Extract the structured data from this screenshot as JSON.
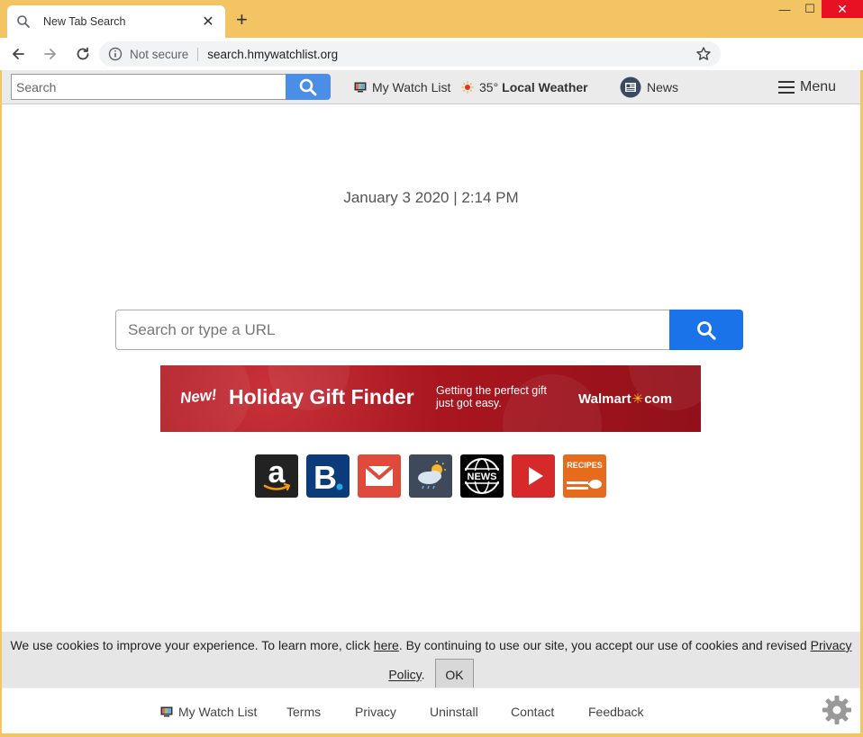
{
  "browser": {
    "tab_title": "New Tab Search",
    "new_tab_label": "+",
    "security_label": "Not secure",
    "url": "search.hmywatchlist.org",
    "window_controls": {
      "minimize": "—",
      "maximize": "☐",
      "close": "✕"
    }
  },
  "topbar": {
    "search_placeholder": "Search",
    "watchlist_label": "My Watch List",
    "weather_temp": "35°",
    "weather_label": "Local Weather",
    "news_label": "News",
    "menu_label": "Menu"
  },
  "main": {
    "datetime": "January 3 2020 | 2:14 PM",
    "search_placeholder": "Search or type a URL"
  },
  "banner": {
    "badge": "New!",
    "title": "Holiday Gift Finder",
    "tagline": "Getting the perfect gift just got easy.",
    "brand_left": "Walmart",
    "brand_right": "com"
  },
  "tiles": {
    "amazon_letter": "a",
    "booking_letter": "B",
    "news_label": "NEWS",
    "recipes_label": "RECIPES"
  },
  "cookie": {
    "text_before": "We use cookies to improve your experience. To learn more, click ",
    "here_link": "here",
    "text_middle": ". By continuing to use our site, you accept our use of cookies and revised ",
    "privacy_link": "Privacy Policy",
    "text_after": ".",
    "ok_label": "OK"
  },
  "footer": {
    "watchlist": "My Watch List",
    "terms": "Terms",
    "privacy": "Privacy",
    "uninstall": "Uninstall",
    "contact": "Contact",
    "feedback": "Feedback"
  },
  "colors": {
    "frame": "#f2c464",
    "search_blue": "#1a73e8",
    "top_search_blue": "#4a8ee8",
    "banner_red": "#a9161f",
    "walmart_yellow": "#ffc220"
  }
}
